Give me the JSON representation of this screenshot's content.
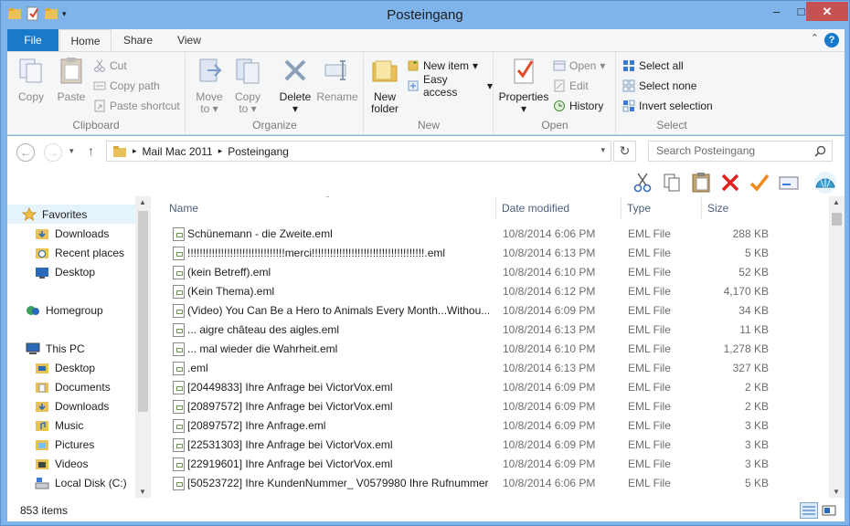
{
  "window": {
    "title": "Posteingang"
  },
  "tabs": {
    "file": "File",
    "home": "Home",
    "share": "Share",
    "view": "View"
  },
  "ribbon": {
    "clipboard": {
      "label": "Clipboard",
      "copy": "Copy",
      "paste": "Paste",
      "cut": "Cut",
      "copy_path": "Copy path",
      "paste_shortcut": "Paste shortcut"
    },
    "organize": {
      "label": "Organize",
      "move_to": "Move",
      "move_to2": "to",
      "copy_to": "Copy",
      "copy_to2": "to",
      "delete": "Delete",
      "rename": "Rename"
    },
    "new": {
      "label": "New",
      "new_folder": "New",
      "new_folder2": "folder",
      "new_item": "New item",
      "easy_access": "Easy access"
    },
    "open": {
      "label": "Open",
      "properties": "Properties",
      "open": "Open",
      "edit": "Edit",
      "history": "History"
    },
    "select": {
      "label": "Select",
      "select_all": "Select all",
      "select_none": "Select none",
      "invert": "Invert selection"
    }
  },
  "address": {
    "crumbs": [
      "Mail Mac 2011",
      "Posteingang"
    ],
    "search_placeholder": "Search Posteingang"
  },
  "nav": {
    "items": [
      {
        "label": "Favorites"
      },
      {
        "label": "Downloads"
      },
      {
        "label": "Recent places"
      },
      {
        "label": "Desktop"
      },
      {
        "label": "Homegroup"
      },
      {
        "label": "This PC"
      },
      {
        "label": "Desktop"
      },
      {
        "label": "Documents"
      },
      {
        "label": "Downloads"
      },
      {
        "label": "Music"
      },
      {
        "label": "Pictures"
      },
      {
        "label": "Videos"
      },
      {
        "label": "Local Disk (C:)"
      }
    ]
  },
  "columns": {
    "name": "Name",
    "date": "Date modified",
    "type": "Type",
    "size": "Size"
  },
  "files": [
    {
      "name": "Schünemann - die Zweite.eml",
      "date": "10/8/2014 6:06 PM",
      "type": "EML File",
      "size": "288 KB"
    },
    {
      "name": "!!!!!!!!!!!!!!!!!!!!!!!!!!!!!!!!merci!!!!!!!!!!!!!!!!!!!!!!!!!!!!!!!!!!!!!.eml",
      "date": "10/8/2014 6:13 PM",
      "type": "EML File",
      "size": "5 KB"
    },
    {
      "name": "(kein Betreff).eml",
      "date": "10/8/2014 6:10 PM",
      "type": "EML File",
      "size": "52 KB"
    },
    {
      "name": "(Kein Thema).eml",
      "date": "10/8/2014 6:12 PM",
      "type": "EML File",
      "size": "4,170 KB"
    },
    {
      "name": "(Video) You Can Be a Hero to Animals Every Month...Withou...",
      "date": "10/8/2014 6:09 PM",
      "type": "EML File",
      "size": "34 KB"
    },
    {
      "name": "... aigre château des aigles.eml",
      "date": "10/8/2014 6:13 PM",
      "type": "EML File",
      "size": "11 KB"
    },
    {
      "name": "... mal wieder die Wahrheit.eml",
      "date": "10/8/2014 6:10 PM",
      "type": "EML File",
      "size": "1,278 KB"
    },
    {
      "name": ".eml",
      "date": "10/8/2014 6:13 PM",
      "type": "EML File",
      "size": "327 KB"
    },
    {
      "name": "[20449833] Ihre Anfrage bei VictorVox.eml",
      "date": "10/8/2014 6:09 PM",
      "type": "EML File",
      "size": "2 KB"
    },
    {
      "name": "[20897572] Ihre Anfrage bei VictorVox.eml",
      "date": "10/8/2014 6:09 PM",
      "type": "EML File",
      "size": "2 KB"
    },
    {
      "name": "[20897572] Ihre Anfrage.eml",
      "date": "10/8/2014 6:09 PM",
      "type": "EML File",
      "size": "3 KB"
    },
    {
      "name": "[22531303] Ihre Anfrage bei VictorVox.eml",
      "date": "10/8/2014 6:09 PM",
      "type": "EML File",
      "size": "3 KB"
    },
    {
      "name": "[22919601] Ihre Anfrage bei VictorVox.eml",
      "date": "10/8/2014 6:09 PM",
      "type": "EML File",
      "size": "3 KB"
    },
    {
      "name": "[50523722] Ihre KundenNummer_ V0579980 Ihre Rufnummer...",
      "date": "10/8/2014 6:06 PM",
      "type": "EML File",
      "size": "5 KB"
    }
  ],
  "status": {
    "count": "853 items"
  }
}
